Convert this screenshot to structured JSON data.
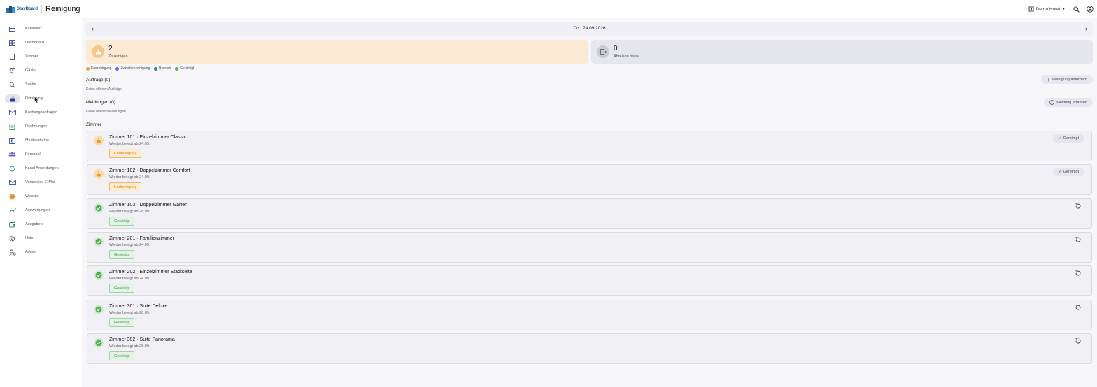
{
  "header": {
    "logo_text": "StayBoard",
    "title": "Reinigung",
    "hotel": "Demo Hotel"
  },
  "sidebar": {
    "items": [
      {
        "label": "Kalender",
        "icon": "calendar-icon"
      },
      {
        "label": "Dashboard",
        "icon": "dashboard-icon"
      },
      {
        "label": "Zimmer",
        "icon": "door-icon"
      },
      {
        "label": "Gäste",
        "icon": "people-icon"
      },
      {
        "label": "Suche",
        "icon": "search-icon"
      },
      {
        "label": "Reinigung",
        "icon": "broom-icon",
        "active": true
      },
      {
        "label": "Buchungsanfragen",
        "icon": "mail-icon"
      },
      {
        "label": "Rechnungen",
        "icon": "receipt-icon"
      },
      {
        "label": "Meldescheine",
        "icon": "id-badge-icon"
      },
      {
        "label": "Personal",
        "icon": "team-icon"
      },
      {
        "label": "Kanal Anbindungen",
        "icon": "sync-icon"
      },
      {
        "label": "Voranreise E-Mail",
        "icon": "envelope-icon"
      },
      {
        "label": "Website",
        "icon": "globe-icon"
      },
      {
        "label": "Auswertungen",
        "icon": "chart-icon"
      },
      {
        "label": "Ausgaben",
        "icon": "wallet-icon"
      },
      {
        "label": "Hotel",
        "icon": "gear-icon"
      },
      {
        "label": "Admin",
        "icon": "admin-icon"
      }
    ]
  },
  "datebar": {
    "date": "Do., 24.09.2026"
  },
  "stats": {
    "to_clean": {
      "value": "2",
      "label": "Zu reinigen"
    },
    "departures": {
      "value": "0",
      "label": "Abreisen heute"
    }
  },
  "legend": [
    {
      "label": "Endreinigung",
      "color": "#e9a23b"
    },
    {
      "label": "Zwischenreinigung",
      "color": "#8a5cd6"
    },
    {
      "label": "Bereich",
      "color": "#1f8a7a"
    },
    {
      "label": "Gereinigt",
      "color": "#5aae5f"
    }
  ],
  "orders": {
    "title": "Aufträge (0)",
    "empty": "Keine offenen Aufträge.",
    "button": "Reinigung anfordern"
  },
  "reports": {
    "title": "Meldungen (0)",
    "empty": "Keine offenen Meldungen.",
    "button": "Meldung erfassen"
  },
  "rooms_title": "Zimmer",
  "rooms": [
    {
      "name": "Zimmer 101 · Einzelzimmer Classic",
      "sub": "Wieder belegt ab 24.09.",
      "status": "Endreinigung",
      "state": "dirty",
      "button": "Gereinigt"
    },
    {
      "name": "Zimmer 102 · Doppelzimmer Comfort",
      "sub": "Wieder belegt ab 24.09.",
      "status": "Endreinigung",
      "state": "dirty",
      "button": "Gereinigt"
    },
    {
      "name": "Zimmer 103 · Doppelzimmer Garten",
      "sub": "Wieder belegt ab 28.09.",
      "status": "Gereinigt",
      "state": "clean"
    },
    {
      "name": "Zimmer 201 · Familienzimmer",
      "sub": "Wieder belegt ab 24.09.",
      "status": "Gereinigt",
      "state": "clean"
    },
    {
      "name": "Zimmer 202 · Einzelzimmer Stadtseite",
      "sub": "Wieder belegt ab 24.09.",
      "status": "Gereinigt",
      "state": "clean"
    },
    {
      "name": "Zimmer 301 · Suite Deluxe",
      "sub": "Wieder belegt ab 28.09.",
      "status": "Gereinigt",
      "state": "clean"
    },
    {
      "name": "Zimmer 302 · Suite Panorama",
      "sub": "Wieder belegt ab 25.09.",
      "status": "Gereinigt",
      "state": "clean"
    }
  ],
  "colors": {
    "accent": "#1f4e79",
    "orange": "#e9a23b",
    "green": "#5aae5f"
  }
}
